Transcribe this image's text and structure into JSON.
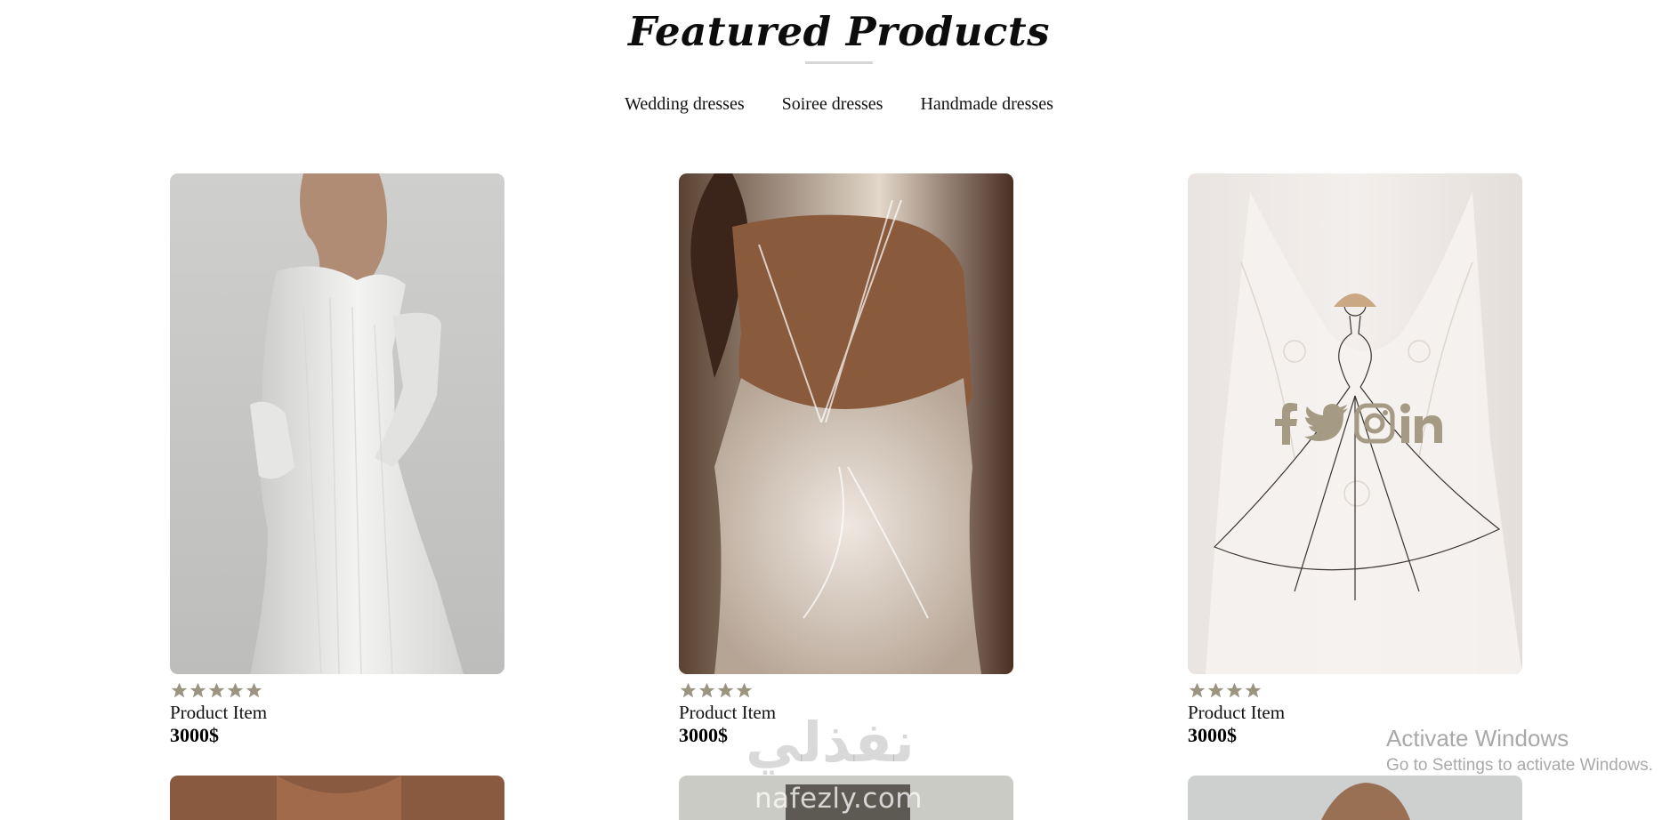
{
  "section": {
    "title": "Featured Products"
  },
  "tabs": [
    "Wedding dresses",
    "Soiree dresses",
    "Handmade dresses"
  ],
  "products": [
    {
      "name": "Product Item",
      "price": "3000$",
      "rating": 5
    },
    {
      "name": "Product Item",
      "price": "3000$",
      "rating": 4
    },
    {
      "name": "Product Item",
      "price": "3000$",
      "rating": 4
    }
  ],
  "social_icons": [
    "facebook-icon",
    "twitter-icon",
    "instagram-icon",
    "linkedin-icon"
  ],
  "watermark": {
    "arabic": "نفذلي",
    "latin": "nafezly.com"
  },
  "windows_notice": {
    "title": "Activate Windows",
    "subtitle": "Go to Settings to activate Windows."
  },
  "colors": {
    "star": "#9b9480",
    "social": "#a59b85",
    "underline": "#d6d6d6"
  }
}
